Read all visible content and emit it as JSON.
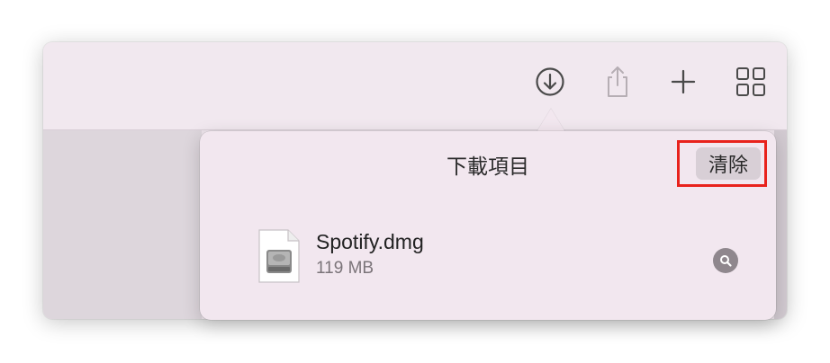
{
  "toolbar": {
    "buttons": [
      {
        "icon": "download-icon",
        "label": "Downloads"
      },
      {
        "icon": "share-icon",
        "label": "Share"
      },
      {
        "icon": "plus-icon",
        "label": "New Tab"
      },
      {
        "icon": "tab-overview-icon",
        "label": "Tab Overview"
      }
    ]
  },
  "downloads_popover": {
    "title": "下載項目",
    "clear_label": "清除",
    "items": [
      {
        "name": "Spotify.dmg",
        "size": "119 MB",
        "icon": "disk-image-icon",
        "action_icon": "magnifier-icon"
      }
    ]
  },
  "colors": {
    "highlight": "#e8221c",
    "toolbar_bg": "#f1e8ef",
    "popover_bg": "#f2e7ef",
    "icon": "#555555"
  }
}
